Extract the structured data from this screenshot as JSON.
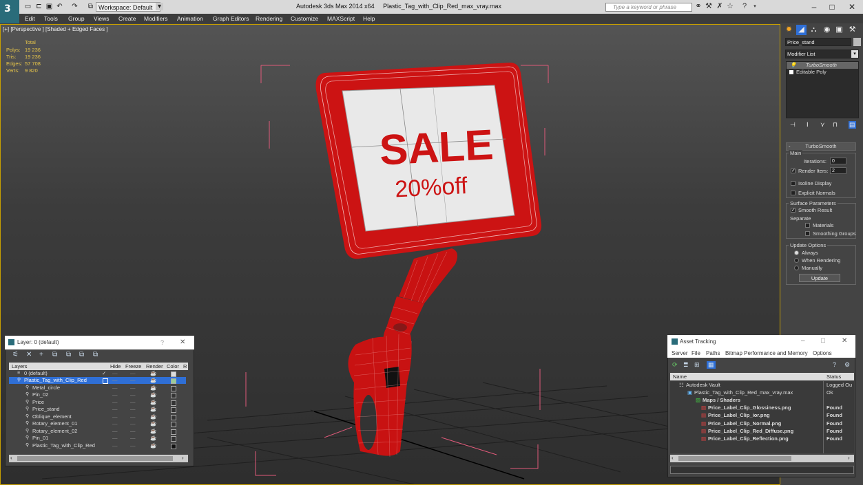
{
  "titlebar": {
    "app_title": "Autodesk 3ds Max  2014 x64",
    "file_title": "Plastic_Tag_with_Clip_Red_max_vray.max",
    "workspace": "Workspace: Default",
    "search_placeholder": "Type a keyword or phrase"
  },
  "menu": [
    "Edit",
    "Tools",
    "Group",
    "Views",
    "Create",
    "Modifiers",
    "Animation",
    "Graph Editors",
    "Rendering",
    "Customize",
    "MAXScript",
    "Help"
  ],
  "viewport": {
    "label": "[+] [Perspective ] [Shaded + Edged Faces ]",
    "stats": {
      "header": "Total",
      "rows": [
        {
          "label": "Polys:",
          "value": "19 236"
        },
        {
          "label": "Tris:",
          "value": "19 236"
        },
        {
          "label": "Edges:",
          "value": "57 708"
        },
        {
          "label": "Verts:",
          "value": "9 820"
        }
      ]
    },
    "sign_text": "SALE",
    "sign_subtext": "20%off"
  },
  "command_panel": {
    "object_name": "Price_stand",
    "modifier_list": "Modifier List",
    "stack": [
      "TurboSmooth",
      "Editable Poly"
    ],
    "turbosmooth": {
      "title": "TurboSmooth",
      "main": "Main",
      "iterations_label": "Iterations:",
      "iterations_value": "0",
      "render_iters_label": "Render Iters:",
      "render_iters_value": "2",
      "isoline": "Isoline Display",
      "explicit_normals": "Explicit Normals",
      "surface_params": "Surface Parameters",
      "smooth_result": "Smooth Result",
      "separate": "Separate",
      "materials": "Materials",
      "smoothing_groups": "Smoothing Groups",
      "update_options": "Update Options",
      "always": "Always",
      "when_rendering": "When Rendering",
      "manually": "Manually",
      "update_button": "Update"
    }
  },
  "layer_panel": {
    "title": "Layer: 0 (default)",
    "help": "?",
    "columns": [
      "Layers",
      "Hide",
      "Freeze",
      "Render",
      "Color",
      "R"
    ],
    "rows": [
      {
        "name": "0 (default)",
        "indent": 0
      },
      {
        "name": "Plastic_Tag_with_Clip_Red",
        "indent": 0
      },
      {
        "name": "Metal_circle",
        "indent": 1
      },
      {
        "name": "Pin_02",
        "indent": 1
      },
      {
        "name": "Price",
        "indent": 1
      },
      {
        "name": "Price_stand",
        "indent": 1
      },
      {
        "name": "Oblique_element",
        "indent": 1
      },
      {
        "name": "Rotary_element_01",
        "indent": 1
      },
      {
        "name": "Rotary_element_02",
        "indent": 1
      },
      {
        "name": "Pin_01",
        "indent": 1
      },
      {
        "name": "Plastic_Tag_with_Clip_Red",
        "indent": 1
      }
    ]
  },
  "asset_panel": {
    "title": "Asset Tracking",
    "menu": [
      "Server",
      "File",
      "Paths",
      "Bitmap Performance and Memory",
      "Options"
    ],
    "columns": [
      "Name",
      "Status"
    ],
    "rows": [
      {
        "name": "Autodesk Vault",
        "status": "Logged Ou"
      },
      {
        "name": "Plastic_Tag_with_Clip_Red_max_vray.max",
        "status": "Ok"
      },
      {
        "name": "Maps / Shaders",
        "status": ""
      },
      {
        "name": "Price_Label_Clip_Glossiness.png",
        "status": "Found"
      },
      {
        "name": "Price_Label_Clip_ior.png",
        "status": "Found"
      },
      {
        "name": "Price_Label_Clip_Normal.png",
        "status": "Found"
      },
      {
        "name": "Price_Label_Clip_Red_Diffuse.png",
        "status": "Found"
      },
      {
        "name": "Price_Label_Clip_Reflection.png",
        "status": "Found"
      }
    ]
  },
  "colors": {
    "accent_red": "#d11a1a",
    "selection_blue": "#2f6fd6",
    "viewport_border": "#c8a000"
  }
}
